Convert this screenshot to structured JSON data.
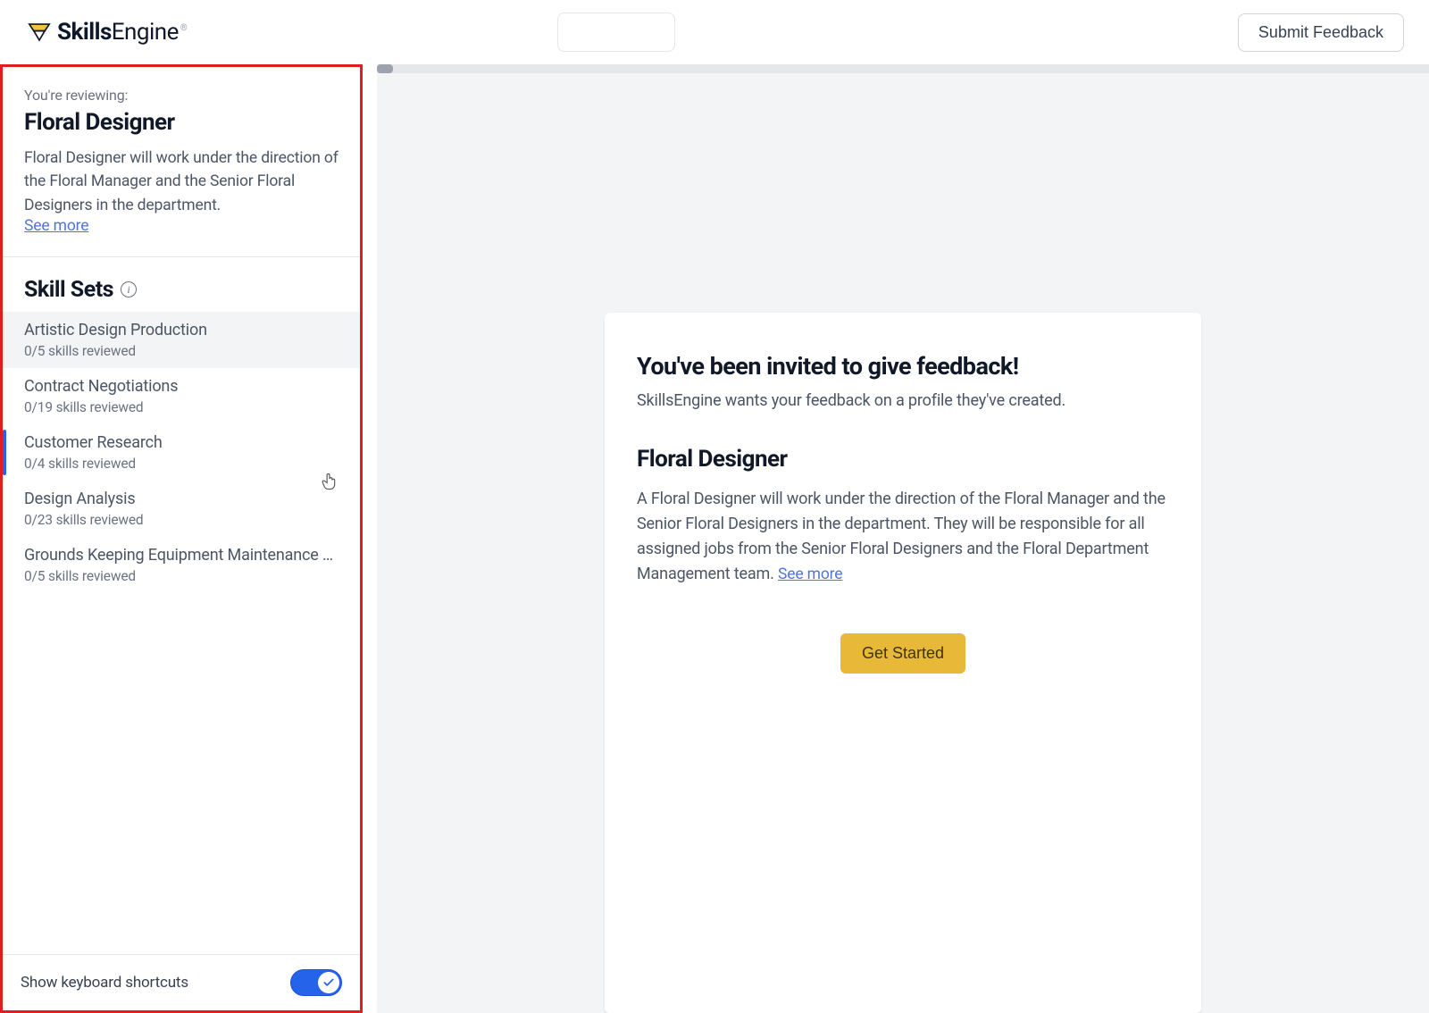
{
  "header": {
    "brand_strong": "Skills",
    "brand_light": "Engine",
    "submit_label": "Submit Feedback"
  },
  "sidebar": {
    "reviewing_label": "You're reviewing:",
    "job_title": "Floral Designer",
    "job_desc": "Floral Designer will work under the direction of the Floral Manager and the Senior Floral Designers in the department.",
    "see_more": "See more",
    "section_title": "Skill Sets",
    "items": [
      {
        "name": "Artistic Design Production",
        "sub": "0/5 skills reviewed"
      },
      {
        "name": "Contract Negotiations",
        "sub": "0/19 skills reviewed"
      },
      {
        "name": "Customer Research",
        "sub": "0/4 skills reviewed"
      },
      {
        "name": "Design Analysis",
        "sub": "0/23 skills reviewed"
      },
      {
        "name": "Grounds Keeping Equipment Maintenance and…",
        "sub": "0/5 skills reviewed"
      }
    ],
    "footer_label": "Show keyboard shortcuts"
  },
  "main": {
    "card_title": "You've been invited to give feedback!",
    "card_sub": "SkillsEngine wants your feedback on a profile they've created.",
    "job_title": "Floral Designer",
    "job_body": "A Floral Designer will work under the direction of the Floral Manager and the Senior Floral Designers in the department. They will be responsible for all assigned jobs from the Senior Floral Designers and the Floral Department Management team. ",
    "see_more": "See more",
    "get_started": "Get Started"
  }
}
